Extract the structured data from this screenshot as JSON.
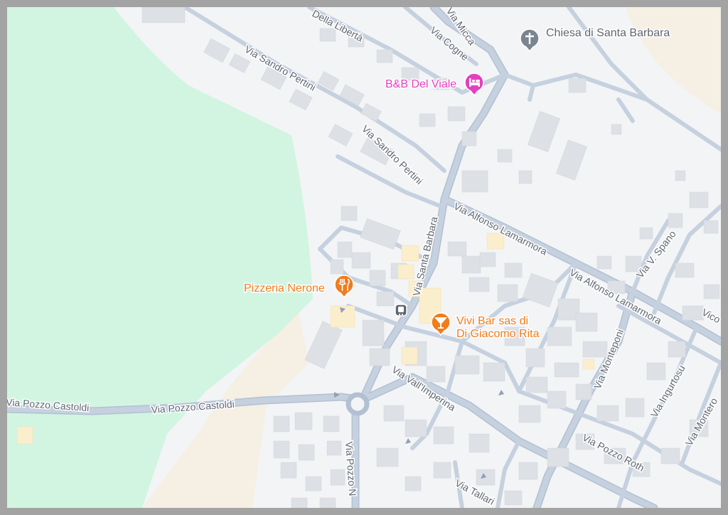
{
  "colors": {
    "background": "#f3f4f6",
    "park": "#d2f5e2",
    "sand": "#f5efe4",
    "road": "#c6d1df",
    "road_edge": "#b3c0d2",
    "building": "#dde0e5",
    "building_highlight": "#fbeecd",
    "restaurant": "#f07c1c",
    "lodging": "#e53fbf",
    "worship": "#7a8591",
    "frame": "#a3a3a3"
  },
  "roads": {
    "della_liberta": "Della Libertà",
    "micca": "Via Micca",
    "cogne": "Via Cogne",
    "pertini_1": "Via Sandro Pertini",
    "pertini_2": "Via Sandro Pertini",
    "santa_barbara": "Via Santa Barbara",
    "lamarmora_1": "Via Alfonso Lamarmora",
    "lamarmora_2": "Via Alfonso Lamarmora",
    "spano": "Via V. Spano",
    "vico": "Vico",
    "monteponi": "Via Monteponi",
    "ingurtosu": "Via Ingurtosu",
    "montero": "Via Montero",
    "pozzo_castoldi_1": "Via Pozzo Castoldi",
    "pozzo_castoldi_2": "Via Pozzo Castoldi",
    "vall_imperina": "Via Vall'Imperina",
    "pozzo_roth": "Via Pozzo Roth",
    "pozzo_n": "Via Pozzo N",
    "tallari": "Via Tallari"
  },
  "pois": {
    "church": {
      "name": "Chiesa di Santa Barbara",
      "icon": "cross-icon"
    },
    "bnb": {
      "name": "B&B Del Viale",
      "icon": "bed-icon"
    },
    "pizzeria": {
      "name": "Pizzeria Nerone",
      "icon": "fork-knife-icon"
    },
    "bar": {
      "name_line1": "Vivi Bar sas di",
      "name_line2": "Di Giacomo Rita",
      "icon": "cocktail-icon"
    },
    "bus_stop": {
      "icon": "bus-stop-icon"
    }
  }
}
